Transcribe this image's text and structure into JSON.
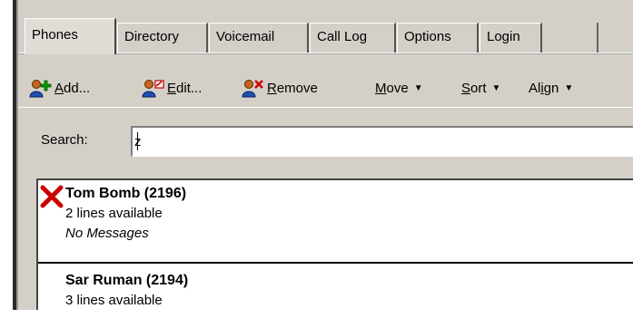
{
  "tabs": [
    {
      "label": "Phones",
      "active": true
    },
    {
      "label": "Directory",
      "active": false
    },
    {
      "label": "Voicemail",
      "active": false
    },
    {
      "label": "Call Log",
      "active": false
    },
    {
      "label": "Options",
      "active": false
    },
    {
      "label": "Login",
      "active": false
    }
  ],
  "toolbar": {
    "add": {
      "pre": "",
      "u": "A",
      "post": "dd...",
      "icon": "user-add-icon"
    },
    "edit": {
      "pre": "",
      "u": "E",
      "post": "dit...",
      "icon": "user-edit-icon"
    },
    "remove": {
      "pre": "",
      "u": "R",
      "post": "emove",
      "icon": "user-remove-icon"
    },
    "move": {
      "pre": "",
      "u": "M",
      "post": "ove"
    },
    "sort": {
      "pre": "",
      "u": "S",
      "post": "ort"
    },
    "align": {
      "pre": "Al",
      "u": "i",
      "post": "gn"
    }
  },
  "search": {
    "label": "Search:",
    "value": "z"
  },
  "contacts": [
    {
      "name": "Tom Bomb (2196)",
      "lines": "2 lines available",
      "messages": "No Messages",
      "status_icon": "unavailable-x-icon"
    },
    {
      "name": "Sar Ruman (2194)",
      "lines": "3 lines available"
    }
  ],
  "colors": {
    "panel": "#d4d0c8",
    "status_x": "#cc0000",
    "icon_person": "#8b4513",
    "icon_add": "#008000"
  }
}
